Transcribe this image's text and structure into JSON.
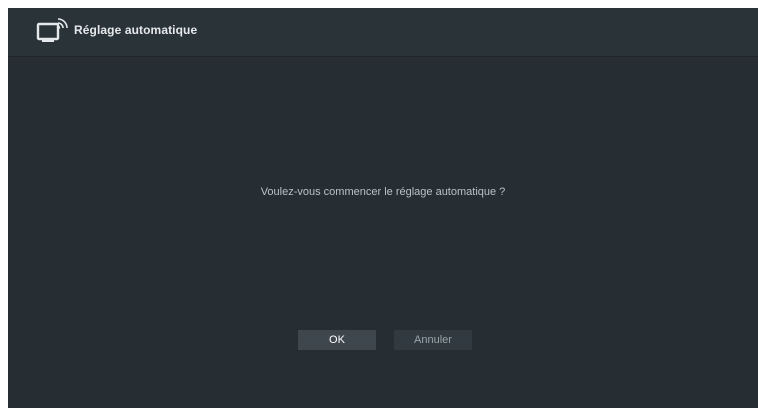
{
  "header": {
    "icon": "tv-antenna-icon",
    "title": "Réglage automatique"
  },
  "dialog": {
    "message": "Voulez-vous commencer le réglage automatique ?",
    "ok_label": "OK",
    "cancel_label": "Annuler"
  },
  "colors": {
    "background": "#262e33",
    "header_background": "#2a3338",
    "focused_button": "#3d474d",
    "unfocused_button": "#303a40"
  }
}
